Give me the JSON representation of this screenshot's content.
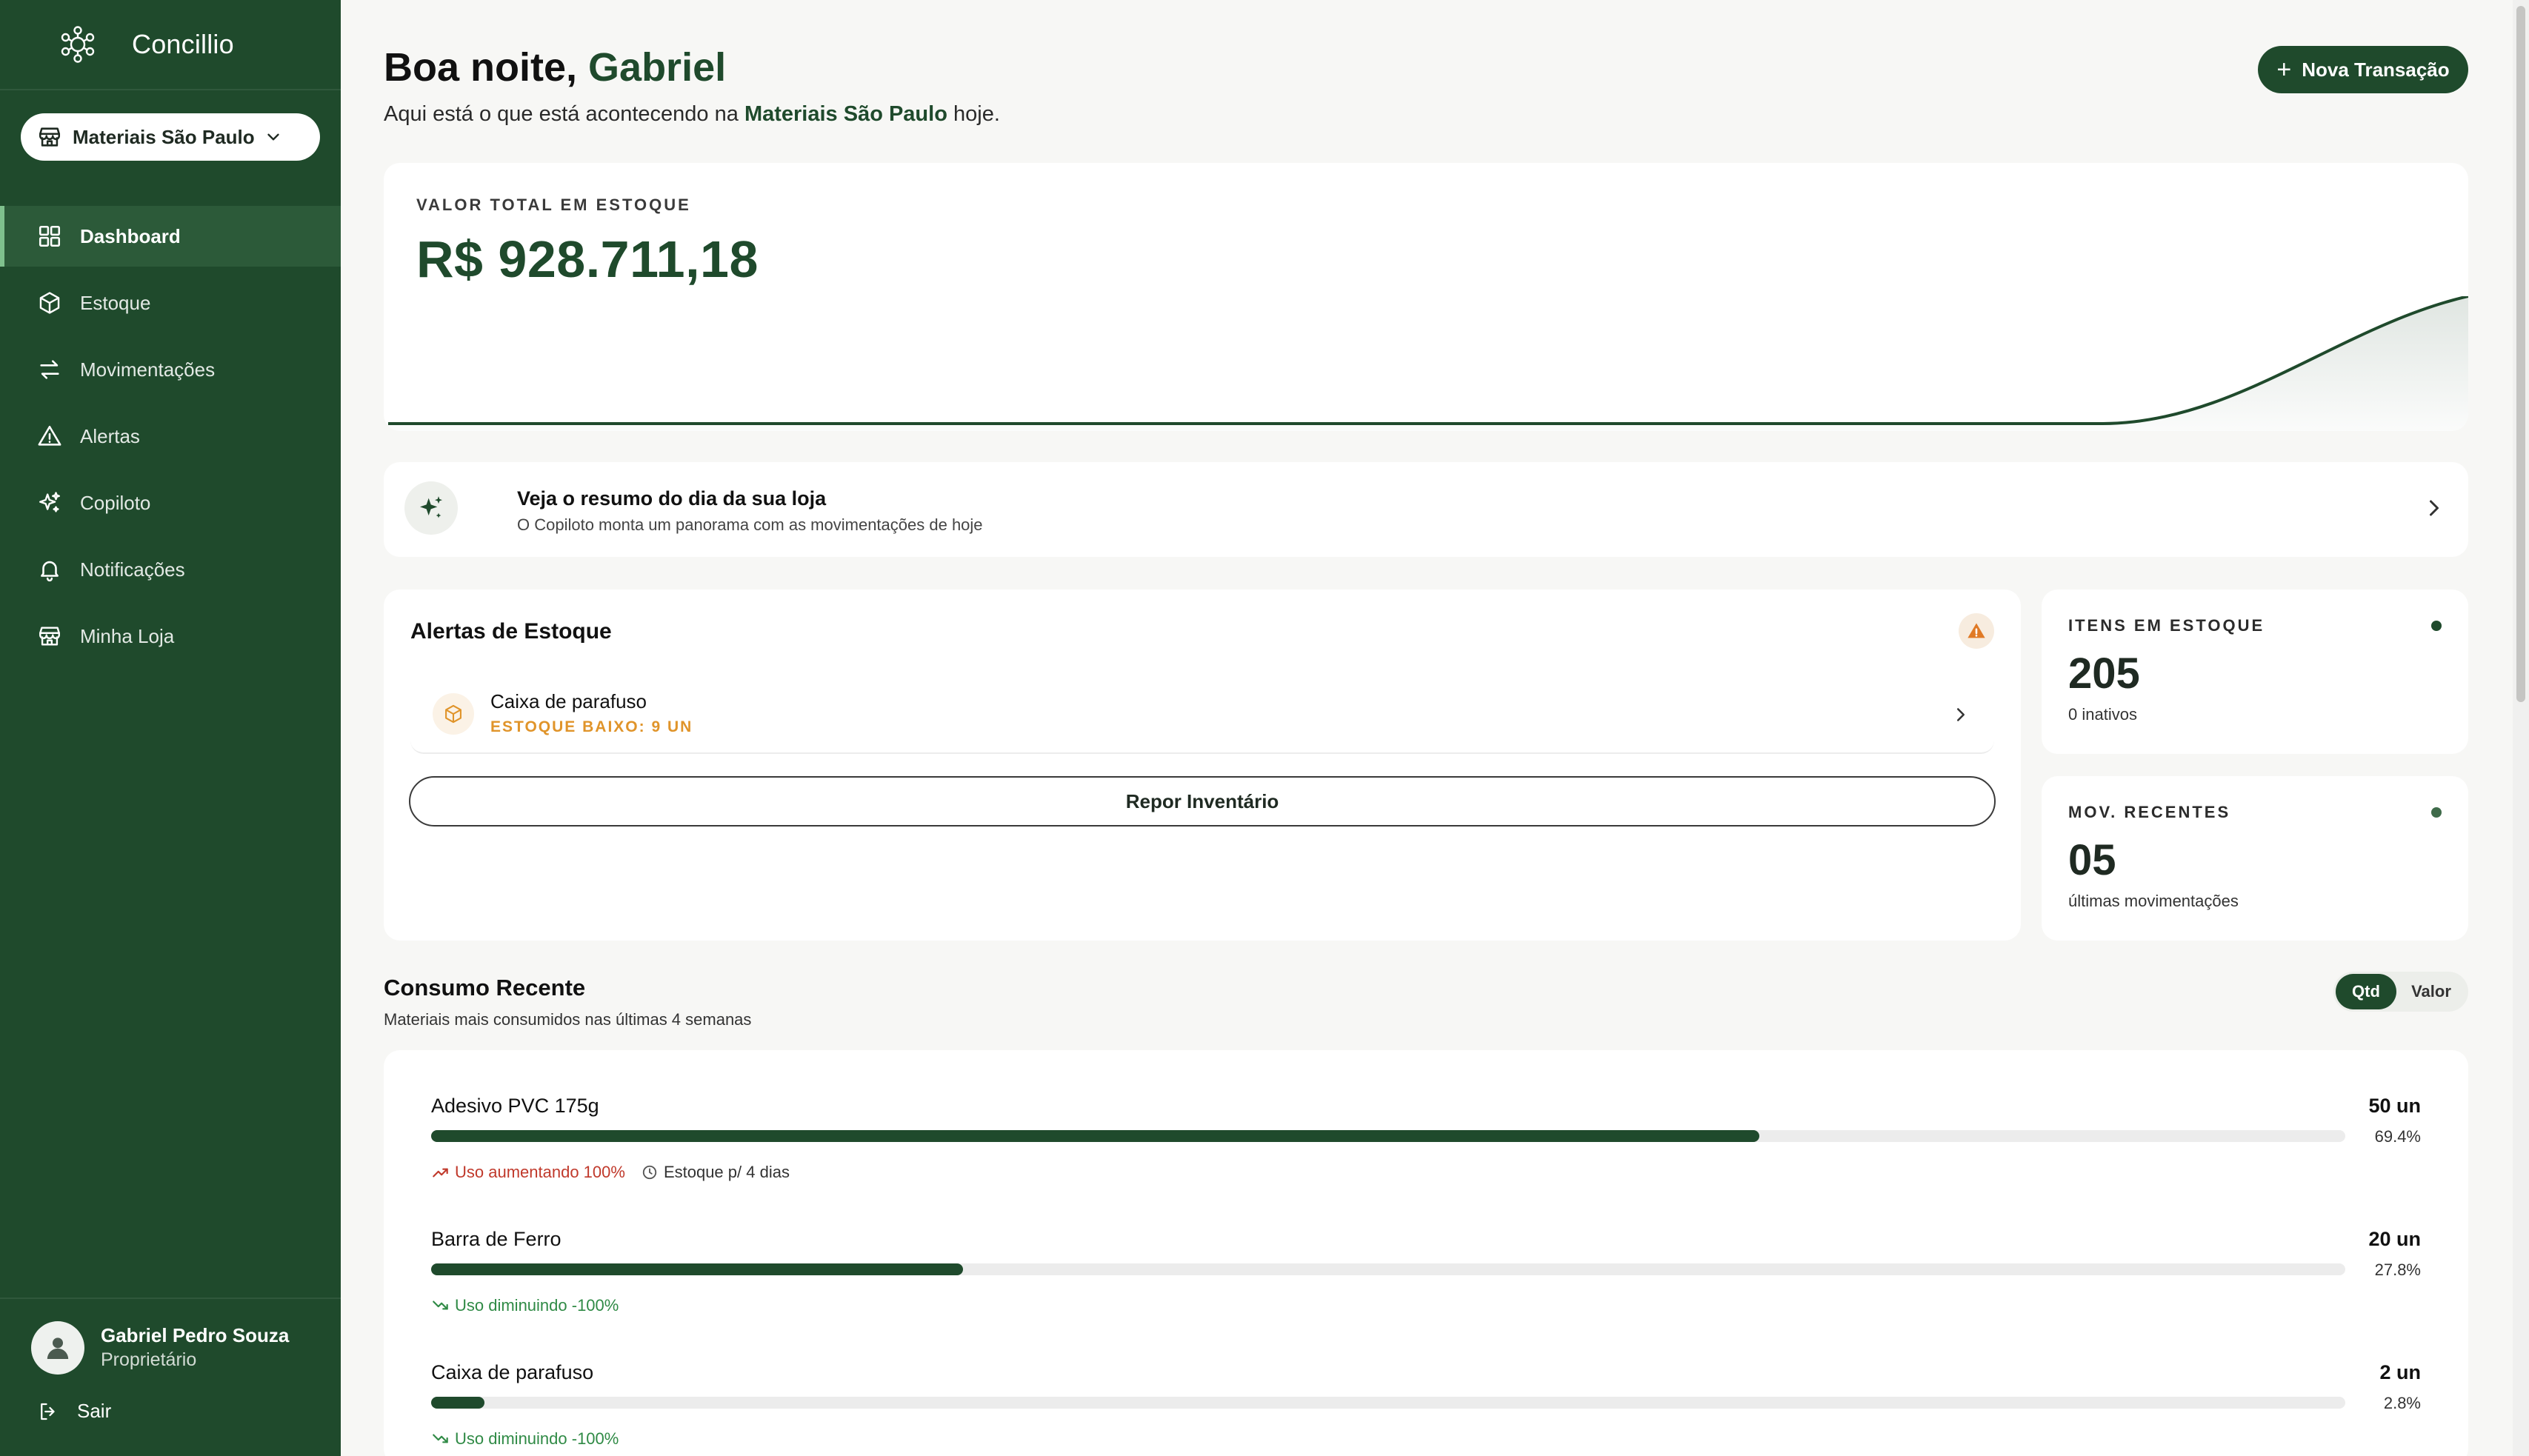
{
  "sidebar": {
    "brand": "Concillio",
    "store_selector": "Materiais São Paulo",
    "nav": [
      {
        "label": "Dashboard",
        "icon": "dashboard-icon",
        "active": true
      },
      {
        "label": "Estoque",
        "icon": "box-icon"
      },
      {
        "label": "Movimentações",
        "icon": "arrows-exchange-icon"
      },
      {
        "label": "Alertas",
        "icon": "warning-icon"
      },
      {
        "label": "Copiloto",
        "icon": "sparkles-icon"
      },
      {
        "label": "Notificações",
        "icon": "bell-icon"
      },
      {
        "label": "Minha Loja",
        "icon": "store-icon"
      }
    ],
    "user": {
      "name": "Gabriel Pedro Souza",
      "role": "Proprietário"
    },
    "logout": "Sair"
  },
  "header": {
    "greeting": "Boa noite,",
    "user_first_name": "Gabriel",
    "subtitle_before": "Aqui está o que está acontecendo na",
    "subtitle_store": "Materiais São Paulo",
    "subtitle_after": "hoje.",
    "new_transaction": "Nova Transação"
  },
  "stock_value": {
    "label": "VALOR TOTAL EM ESTOQUE",
    "amount": "R$ 928.711,18"
  },
  "copilot": {
    "title": "Veja o resumo do dia da sua loja",
    "description": "O Copiloto monta um panorama com as movimentações de hoje"
  },
  "alerts": {
    "title": "Alertas de Estoque",
    "items": [
      {
        "name": "Caixa de parafuso",
        "status": "ESTOQUE BAIXO: 9 UN"
      }
    ],
    "restock_button": "Repor Inventário"
  },
  "stats": [
    {
      "label": "ITENS EM ESTOQUE",
      "value": "205",
      "sub": "0 inativos",
      "dot_color": "#1f4a2c"
    },
    {
      "label": "MOV. RECENTES",
      "value": "05",
      "sub": "últimas movimentações",
      "dot_color": "#3f6b4a"
    }
  ],
  "consumption": {
    "title": "Consumo Recente",
    "subtitle": "Materiais mais consumidos nas últimas 4 semanas",
    "toggle": {
      "qty": "Qtd",
      "value": "Valor",
      "selected": "Qtd"
    },
    "items": [
      {
        "name": "Adesivo PVC 175g",
        "qty": "50 un",
        "pct_label": "69.4%",
        "pct": 69.4,
        "trend": "Uso aumentando 100%",
        "trend_dir": "up",
        "days": "Estoque p/ 4 dias"
      },
      {
        "name": "Barra de Ferro",
        "qty": "20 un",
        "pct_label": "27.8%",
        "pct": 27.8,
        "trend": "Uso diminuindo -100%",
        "trend_dir": "down"
      },
      {
        "name": "Caixa de parafuso",
        "qty": "2 un",
        "pct_label": "2.8%",
        "pct": 2.8,
        "trend": "Uso diminuindo -100%",
        "trend_dir": "down"
      }
    ]
  },
  "colors": {
    "sidebar_bg": "#1f4a2c",
    "accent": "#1f4a2c",
    "warning": "#e0942a",
    "trend_up": "#c0392b",
    "trend_down": "#2f8a45"
  }
}
